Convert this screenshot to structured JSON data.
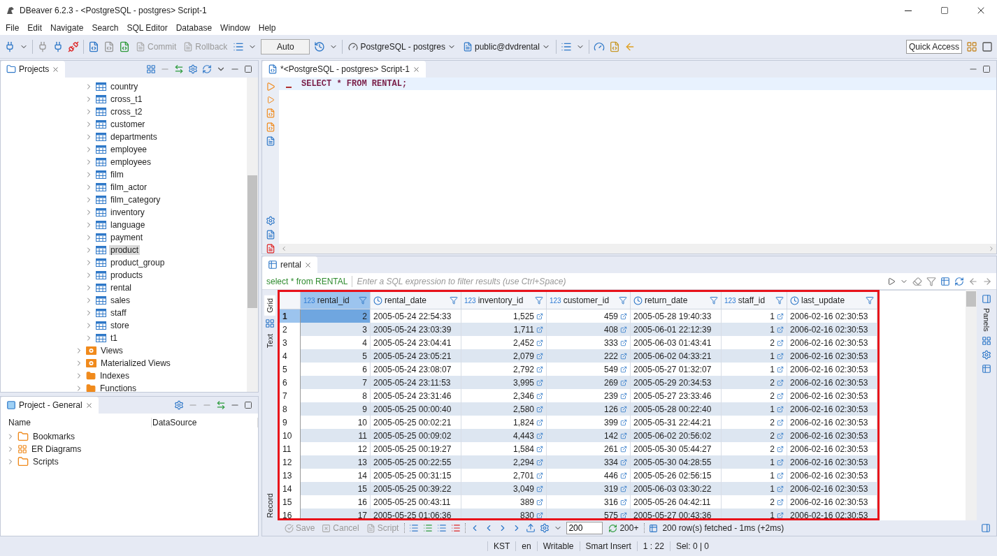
{
  "window": {
    "title": "DBeaver 6.2.3 - <PostgreSQL - postgres> Script-1"
  },
  "menu": [
    "File",
    "Edit",
    "Navigate",
    "Search",
    "SQL Editor",
    "Database",
    "Window",
    "Help"
  ],
  "toolbar": {
    "buttons": [
      {
        "label": "Commit",
        "disabled": true
      },
      {
        "label": "Rollback",
        "disabled": true
      }
    ],
    "transaction_mode": "Auto",
    "connection": "PostgreSQL - postgres",
    "schema": "public@dvdrental",
    "quick_access": "Quick Access"
  },
  "projects_panel": {
    "title": "Projects",
    "tables": [
      {
        "label": "country",
        "selected": false
      },
      {
        "label": "cross_t1",
        "selected": false
      },
      {
        "label": "cross_t2",
        "selected": false
      },
      {
        "label": "customer",
        "selected": false
      },
      {
        "label": "departments",
        "selected": false
      },
      {
        "label": "employee",
        "selected": false
      },
      {
        "label": "employees",
        "selected": false
      },
      {
        "label": "film",
        "selected": false
      },
      {
        "label": "film_actor",
        "selected": false
      },
      {
        "label": "film_category",
        "selected": false
      },
      {
        "label": "inventory",
        "selected": false
      },
      {
        "label": "language",
        "selected": false
      },
      {
        "label": "payment",
        "selected": false
      },
      {
        "label": "product",
        "selected": true
      },
      {
        "label": "product_group",
        "selected": false
      },
      {
        "label": "products",
        "selected": false
      },
      {
        "label": "rental",
        "selected": false
      },
      {
        "label": "sales",
        "selected": false
      },
      {
        "label": "staff",
        "selected": false
      },
      {
        "label": "store",
        "selected": false
      },
      {
        "label": "t1",
        "selected": false
      }
    ],
    "folders": [
      {
        "label": "Views",
        "kind": "view"
      },
      {
        "label": "Materialized Views",
        "kind": "view"
      },
      {
        "label": "Indexes",
        "kind": "folder"
      },
      {
        "label": "Functions",
        "kind": "folder"
      }
    ]
  },
  "project_general": {
    "title": "Project - General",
    "columns": [
      "Name",
      "DataSource"
    ],
    "items": [
      {
        "label": "Bookmarks",
        "kind": "bookmarks"
      },
      {
        "label": "ER Diagrams",
        "kind": "diagrams"
      },
      {
        "label": "Scripts",
        "kind": "scripts"
      }
    ]
  },
  "editor": {
    "tab": "*<PostgreSQL - postgres> Script-1",
    "sql": "SELECT * FROM RENTAL;"
  },
  "results": {
    "tab": "rental",
    "query": "select * from RENTAL",
    "filter_placeholder": "Enter a SQL expression to filter results (use Ctrl+Space)",
    "side_tabs": [
      {
        "label": "Grid",
        "selected": true
      },
      {
        "label": "Text",
        "selected": false
      },
      {
        "label": "Record",
        "selected": false
      }
    ],
    "panels_label": "Panels",
    "columns": [
      {
        "name": "rental_id",
        "kind": "number",
        "type_label": "123",
        "selected": true,
        "link": false
      },
      {
        "name": "rental_date",
        "kind": "date",
        "selected": false,
        "link": false
      },
      {
        "name": "inventory_id",
        "kind": "number",
        "type_label": "123",
        "selected": false,
        "link": true
      },
      {
        "name": "customer_id",
        "kind": "number",
        "type_label": "123",
        "selected": false,
        "link": true
      },
      {
        "name": "return_date",
        "kind": "date",
        "selected": false,
        "link": false
      },
      {
        "name": "staff_id",
        "kind": "number",
        "type_label": "123",
        "selected": false,
        "link": true
      },
      {
        "name": "last_update",
        "kind": "date",
        "selected": false,
        "link": false
      }
    ],
    "rows": [
      {
        "number": "1",
        "selected": true,
        "cells": [
          "2",
          "2005-05-24 22:54:33",
          "1,525",
          "459",
          "2005-05-28 19:40:33",
          "1",
          "2006-02-16 02:30:53"
        ]
      },
      {
        "number": "2",
        "selected": false,
        "cells": [
          "3",
          "2005-05-24 23:03:39",
          "1,711",
          "408",
          "2005-06-01 22:12:39",
          "1",
          "2006-02-16 02:30:53"
        ]
      },
      {
        "number": "3",
        "selected": false,
        "cells": [
          "4",
          "2005-05-24 23:04:41",
          "2,452",
          "333",
          "2005-06-03 01:43:41",
          "2",
          "2006-02-16 02:30:53"
        ]
      },
      {
        "number": "4",
        "selected": false,
        "cells": [
          "5",
          "2005-05-24 23:05:21",
          "2,079",
          "222",
          "2005-06-02 04:33:21",
          "1",
          "2006-02-16 02:30:53"
        ]
      },
      {
        "number": "5",
        "selected": false,
        "cells": [
          "6",
          "2005-05-24 23:08:07",
          "2,792",
          "549",
          "2005-05-27 01:32:07",
          "1",
          "2006-02-16 02:30:53"
        ]
      },
      {
        "number": "6",
        "selected": false,
        "cells": [
          "7",
          "2005-05-24 23:11:53",
          "3,995",
          "269",
          "2005-05-29 20:34:53",
          "2",
          "2006-02-16 02:30:53"
        ]
      },
      {
        "number": "7",
        "selected": false,
        "cells": [
          "8",
          "2005-05-24 23:31:46",
          "2,346",
          "239",
          "2005-05-27 23:33:46",
          "2",
          "2006-02-16 02:30:53"
        ]
      },
      {
        "number": "8",
        "selected": false,
        "cells": [
          "9",
          "2005-05-25 00:00:40",
          "2,580",
          "126",
          "2005-05-28 00:22:40",
          "1",
          "2006-02-16 02:30:53"
        ]
      },
      {
        "number": "9",
        "selected": false,
        "cells": [
          "10",
          "2005-05-25 00:02:21",
          "1,824",
          "399",
          "2005-05-31 22:44:21",
          "2",
          "2006-02-16 02:30:53"
        ]
      },
      {
        "number": "10",
        "selected": false,
        "cells": [
          "11",
          "2005-05-25 00:09:02",
          "4,443",
          "142",
          "2005-06-02 20:56:02",
          "2",
          "2006-02-16 02:30:53"
        ]
      },
      {
        "number": "11",
        "selected": false,
        "cells": [
          "12",
          "2005-05-25 00:19:27",
          "1,584",
          "261",
          "2005-05-30 05:44:27",
          "2",
          "2006-02-16 02:30:53"
        ]
      },
      {
        "number": "12",
        "selected": false,
        "cells": [
          "13",
          "2005-05-25 00:22:55",
          "2,294",
          "334",
          "2005-05-30 04:28:55",
          "1",
          "2006-02-16 02:30:53"
        ]
      },
      {
        "number": "13",
        "selected": false,
        "cells": [
          "14",
          "2005-05-25 00:31:15",
          "2,701",
          "446",
          "2005-05-26 02:56:15",
          "1",
          "2006-02-16 02:30:53"
        ]
      },
      {
        "number": "14",
        "selected": false,
        "cells": [
          "15",
          "2005-05-25 00:39:22",
          "3,049",
          "319",
          "2005-06-03 03:30:22",
          "1",
          "2006-02-16 02:30:53"
        ]
      },
      {
        "number": "15",
        "selected": false,
        "cells": [
          "16",
          "2005-05-25 00:43:11",
          "389",
          "316",
          "2005-05-26 04:42:11",
          "2",
          "2006-02-16 02:30:53"
        ]
      },
      {
        "number": "16",
        "selected": false,
        "cells": [
          "17",
          "2005-05-25 01:06:36",
          "830",
          "575",
          "2005-05-27 00:43:36",
          "1",
          "2006-02-16 02:30:53"
        ]
      }
    ],
    "bottom_buttons": [
      {
        "label": "Save",
        "disabled": true
      },
      {
        "label": "Cancel",
        "disabled": true
      },
      {
        "label": "Script",
        "disabled": true
      }
    ],
    "fetch_size": "200",
    "fetch_more": "200+",
    "fetch_status": "200 row(s) fetched - 1ms (+2ms)"
  },
  "status_bar": [
    "KST",
    "en",
    "Writable",
    "Smart Insert",
    "1 : 22",
    "Sel: 0 | 0"
  ]
}
